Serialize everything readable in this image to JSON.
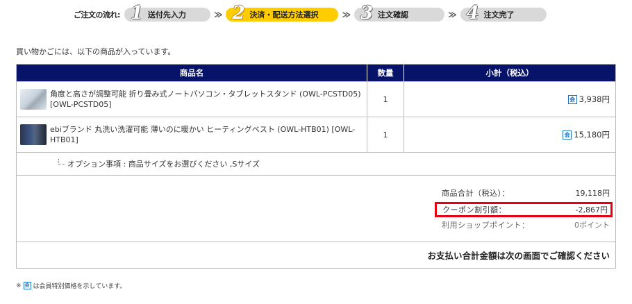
{
  "flow": {
    "label": "ご注文の流れ:",
    "steps": [
      {
        "num": "1",
        "label": "送付先入力"
      },
      {
        "num": "2",
        "label": "決済・配送方法選択"
      },
      {
        "num": "3",
        "label": "注文確認"
      },
      {
        "num": "4",
        "label": "注文完了"
      }
    ],
    "arrow": "≫",
    "active_step": 2,
    "active_color": "#ffcc00",
    "inactive_color": "#d9d9d9"
  },
  "intro": "買い物かごには、以下の商品が入っています。",
  "table": {
    "header_color": "#061368",
    "headers": [
      "商品名",
      "数量",
      "小計（税込）"
    ],
    "items": [
      {
        "name": "角度と高さが調整可能 折り畳み式ノートパソコン・タブレットスタンド (OWL-PCSTD05) [OWL-PCSTD05]",
        "qty": "1",
        "member_icon": "会",
        "price": "3,938円"
      },
      {
        "name": "ebiブランド 丸洗い洗濯可能 薄いのに暖かい ヒーティングベスト (OWL-HTB01) [OWL-HTB01]",
        "qty": "1",
        "member_icon": "会",
        "price": "15,180円"
      }
    ],
    "option": "オプション事項 : 商品サイズをお選びください ,Sサイズ",
    "summary": {
      "subtotal_label": "商品合計（税込）：",
      "subtotal_value": "19,118円",
      "coupon_label": "クーポン割引額：",
      "coupon_value": "-2,867円",
      "points_label": "利用ショップポイント：",
      "points_value": "0ポイント",
      "highlight_color": "#e60012"
    },
    "footer": "お支払い合計金額は次の画面でご確認ください"
  },
  "note": {
    "prefix": "※",
    "icon": "会",
    "text": "は会員特別価格を示しています。"
  }
}
